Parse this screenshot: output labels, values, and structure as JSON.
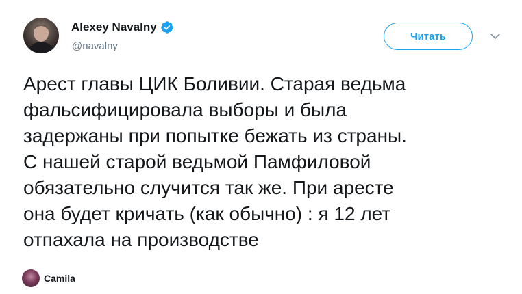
{
  "author": {
    "name": "Alexey Navalny",
    "handle": "@navalny",
    "verified": true
  },
  "follow": {
    "label": "Читать"
  },
  "tweet": {
    "text": "Арест главы ЦИК Боливии. Старая ведьма\nфальсифицировала выборы и была\nзадержаны при попытке бежать из страны.\nС нашей старой ведьмой Памфиловой\nобязательно случится так же. При аресте\nона будет кричать (как обычно) : я 12 лет\nотпахала на производстве"
  },
  "attribution": {
    "user": "Camila"
  },
  "colors": {
    "accent": "#1da1f2",
    "text": "#14171a",
    "muted": "#657786"
  },
  "icons": {
    "verified": "verified-badge-icon",
    "more": "chevron-down-icon"
  }
}
